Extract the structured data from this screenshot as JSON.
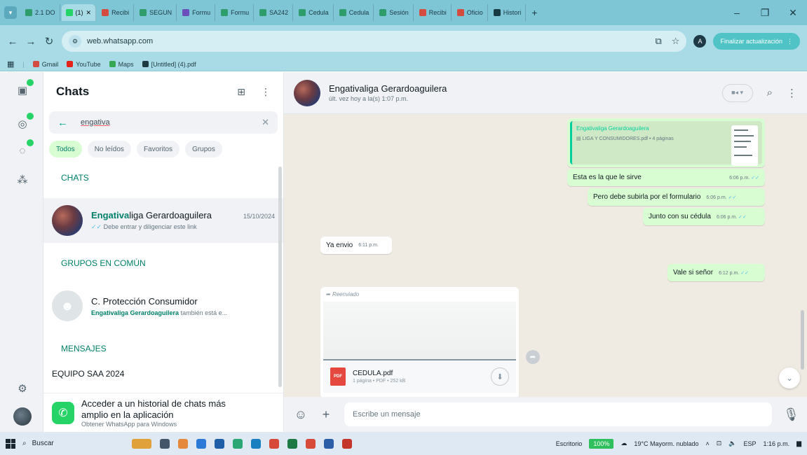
{
  "browser": {
    "tabs": [
      {
        "label": "2.1 DO",
        "color": "#2e9d6b",
        "active": false
      },
      {
        "label": "(1)",
        "color": "#25d366",
        "active": true
      },
      {
        "label": "Recibi",
        "color": "#d44b3f",
        "active": false
      },
      {
        "label": "SEGUN",
        "color": "#2e9d6b",
        "active": false
      },
      {
        "label": "Formu",
        "color": "#6b4fbb",
        "active": false
      },
      {
        "label": "Formu",
        "color": "#2e9d6b",
        "active": false
      },
      {
        "label": "SA242",
        "color": "#2e9d6b",
        "active": false
      },
      {
        "label": "Cedula",
        "color": "#2e9d6b",
        "active": false
      },
      {
        "label": "Cedula",
        "color": "#2e9d6b",
        "active": false
      },
      {
        "label": "Sesión",
        "color": "#2e9d6b",
        "active": false
      },
      {
        "label": "Recibi",
        "color": "#d44b3f",
        "active": false
      },
      {
        "label": "Oficio",
        "color": "#d44b3f",
        "active": false
      },
      {
        "label": "Histori",
        "color": "#1b3b44",
        "active": false
      }
    ],
    "url": "web.whatsapp.com",
    "update_label": "Finalizar actualización",
    "profile_initial": "A",
    "bookmarks": [
      {
        "label": "Gmail",
        "color": "#d44b3f"
      },
      {
        "label": "YouTube",
        "color": "#e62117"
      },
      {
        "label": "Maps",
        "color": "#34a853"
      },
      {
        "label": "[Untitled] (4).pdf",
        "color": "#1f3b42"
      }
    ]
  },
  "chat_list": {
    "title": "Chats",
    "search_value": "engativa",
    "filters": [
      {
        "label": "Todos",
        "active": true
      },
      {
        "label": "No leídos",
        "active": false
      },
      {
        "label": "Favoritos",
        "active": false
      },
      {
        "label": "Grupos",
        "active": false
      }
    ],
    "sections": {
      "chats": "CHATS",
      "groups": "GRUPOS EN COMÚN",
      "messages": "MENSAJES"
    },
    "chat_row": {
      "name_highlight": "Engativa",
      "name_rest": "liga Gerardoaguilera",
      "time": "15/10/2024",
      "preview": "Debe entrar y diligenciar este link"
    },
    "group_row": {
      "name": "C. Protección Consumidor",
      "preview_highlight": "Engativaliga Gerardoaguilera",
      "preview_rest": "también está e..."
    },
    "partial_message": "EQUIPO SAA 2024",
    "promo": {
      "title_line1": "Acceder a un historial de chats más",
      "title_line2": "amplio en la aplicación",
      "subtitle": "Obtener WhatsApp para Windows"
    }
  },
  "conversation": {
    "contact_name": "Engativaliga Gerardoaguilera",
    "status": "últ. vez hoy a la(s) 1:07 p.m.",
    "quoted": {
      "name": "Engativaliga Gerardoaguilera",
      "doc": "LIGA Y CONSUMIDORES.pdf • 4 páginas"
    },
    "messages": [
      {
        "text": "Esta es la que le sirve",
        "time": "6:06 p.m."
      },
      {
        "text": "Pero debe subirla por el formulario",
        "time": "6:06 p.m."
      },
      {
        "text": "Junto con su cédula",
        "time": "6:06 p.m."
      },
      {
        "text": "Ya envio",
        "time": "6:11 p.m."
      },
      {
        "text": "Vale si señor",
        "time": "6:12 p.m."
      }
    ],
    "forwarded": {
      "label": "Reenviado",
      "file_name": "CEDULA.pdf",
      "file_meta": "1 página • PDF • 252 kB",
      "pdf_tag": "PDF"
    },
    "composer_placeholder": "Escribe un mensaje"
  },
  "taskbar": {
    "search_label": "Buscar",
    "desktop_label": "Escritorio",
    "zoom": "100%",
    "weather": "19°C Mayorm. nublado",
    "language": "ESP",
    "clock": "1:16 p.m."
  }
}
